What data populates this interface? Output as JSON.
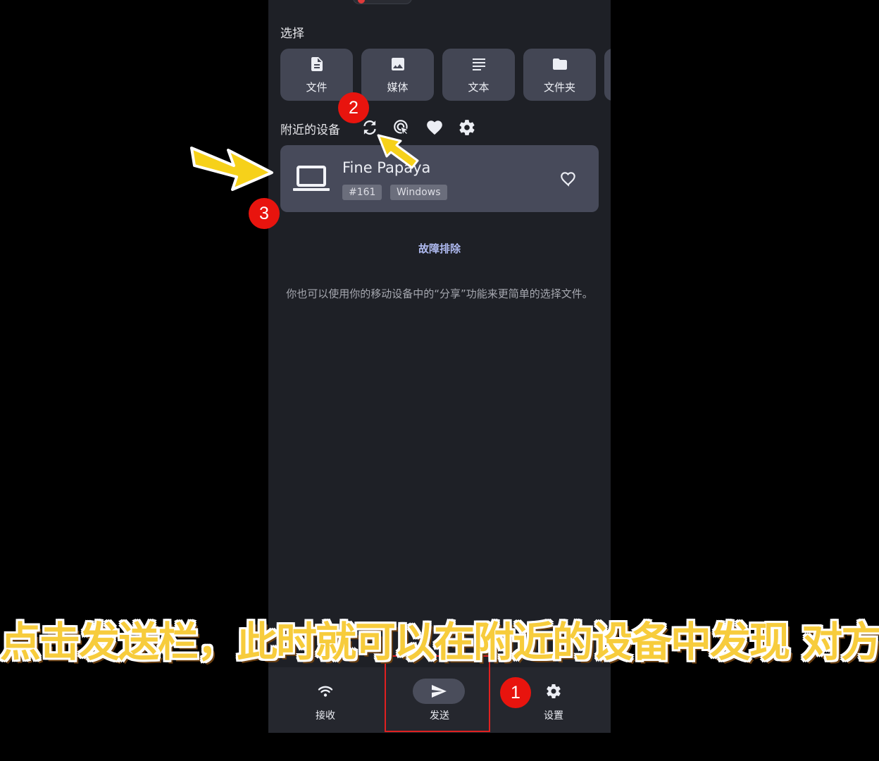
{
  "select": {
    "title": "选择",
    "buttons": [
      {
        "label": "文件",
        "icon": "file-icon"
      },
      {
        "label": "媒体",
        "icon": "image-icon"
      },
      {
        "label": "文本",
        "icon": "text-icon"
      },
      {
        "label": "文件夹",
        "icon": "folder-icon"
      }
    ]
  },
  "nearby": {
    "title": "附近的设备",
    "tools": [
      "refresh-icon",
      "target-cursor-icon",
      "heart-filled-icon",
      "gear-icon"
    ]
  },
  "device": {
    "name": "Fine Papaya",
    "tags": [
      "#161",
      "Windows"
    ],
    "icon": "laptop-icon"
  },
  "troubleshoot_label": "故障排除",
  "hint_text": "你也可以使用你的移动设备中的“分享”功能来更简单的选择文件。",
  "bottom_nav": {
    "items": [
      {
        "label": "接收",
        "icon": "wifi-icon"
      },
      {
        "label": "发送",
        "icon": "send-icon"
      },
      {
        "label": "设置",
        "icon": "gear-icon"
      }
    ]
  },
  "annotations": {
    "badges": [
      "1",
      "2",
      "3"
    ],
    "caption": "点击发送栏，此时就可以在附近的设备中发现 对方了",
    "badge_color": "#e8140e",
    "arrow_color": "#f6d11a"
  }
}
